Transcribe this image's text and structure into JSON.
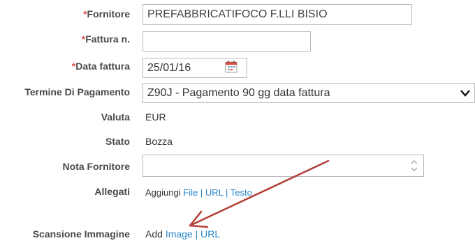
{
  "form": {
    "fornitore": {
      "required": "*",
      "label": "Fornitore",
      "value": "PREFABBRICATIFOCO F.LLI BISIO"
    },
    "fattura": {
      "required": "*",
      "label": "Fattura n.",
      "value": ""
    },
    "data_fattura": {
      "required": "*",
      "label": "Data fattura",
      "value": "25/01/16"
    },
    "termine": {
      "label": "Termine Di Pagamento",
      "value": "Z90J - Pagamento 90 gg data fattura"
    },
    "valuta": {
      "label": "Valuta",
      "value": "EUR"
    },
    "stato": {
      "label": "Stato",
      "value": "Bozza"
    },
    "nota": {
      "label": "Nota Fornitore",
      "value": ""
    },
    "allegati": {
      "label": "Allegati",
      "prefix": "Aggiungi",
      "file": "File",
      "sep1": "|",
      "url": "URL",
      "sep2": "|",
      "testo": "Testo"
    },
    "scansione": {
      "label": "Scansione Immagine",
      "prefix": "Add",
      "image": "Image",
      "sep": "|",
      "url": "URL"
    }
  },
  "colors": {
    "required": "#d9534f",
    "link": "#2a86c9",
    "arrow": "#b5413a"
  },
  "icons": {
    "calendar": "calendar-icon",
    "dropdown": "chevron-down-icon",
    "spinner": "spinner-arrows-icon",
    "arrow": "annotation-arrow"
  }
}
